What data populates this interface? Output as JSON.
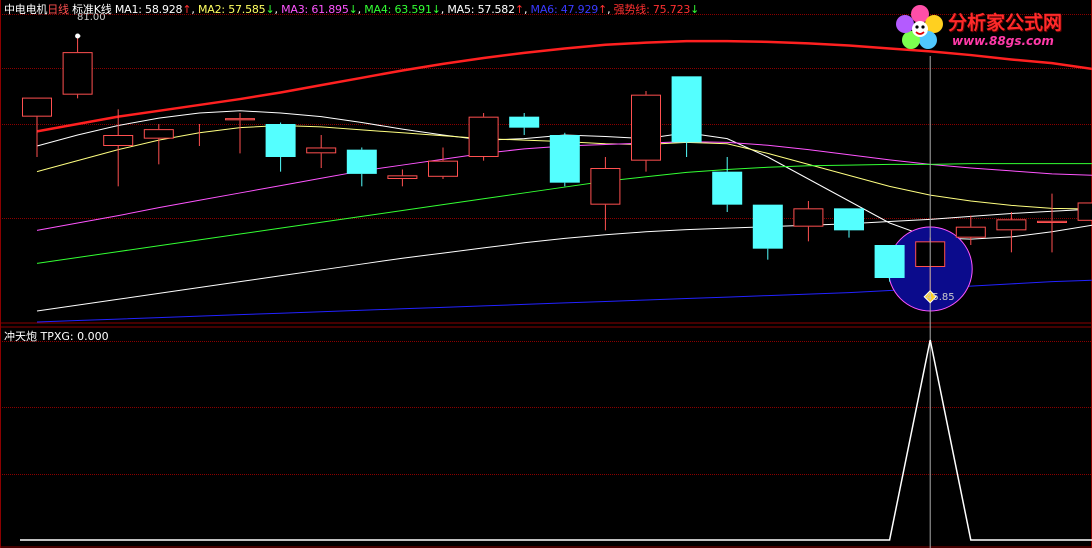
{
  "header": {
    "stock_name": "中电电机",
    "period": "日线",
    "chart_type": "标准K线",
    "ma1_label": "MA1:",
    "ma1_value": "58.928",
    "ma1_arrow": "↑",
    "ma2_label": "MA2:",
    "ma2_value": "57.585",
    "ma2_arrow": "↓",
    "ma3_label": "MA3:",
    "ma3_value": "61.895",
    "ma3_arrow": "↓",
    "ma4_label": "MA4:",
    "ma4_value": "63.591",
    "ma4_arrow": "↓",
    "ma5_label": "MA5:",
    "ma5_value": "57.582",
    "ma5_arrow": "↑",
    "ma6_label": "MA6:",
    "ma6_value": "47.929",
    "ma6_arrow": "↑",
    "trend_label": "强势线:",
    "trend_value": "75.723",
    "trend_arrow": "↓"
  },
  "indicator": {
    "name": "冲天炮",
    "field_label": "TPXG:",
    "field_value": "0.000"
  },
  "annotations": {
    "high_price": "81.00",
    "low_price": "45.85"
  },
  "logo": {
    "title": "分析家公式网",
    "url": "www.88gs.com"
  },
  "colors": {
    "background": "#000000",
    "grid": "#8b0000",
    "up_candle": "#ff5050",
    "down_candle": "#54ffff",
    "ma1": "#ffffff",
    "ma2": "#ffff80",
    "ma3": "#ff55ff",
    "ma4": "#33ff33",
    "ma5": "#ffffff",
    "ma6": "#2222ff",
    "trend": "#ff2020",
    "highlight_circle": "#0b0b8c"
  },
  "chart_data": {
    "type": "candlestick",
    "price_range": [
      42,
      84
    ],
    "candles": [
      {
        "o": 70.0,
        "h": 72.6,
        "l": 64.5,
        "c": 72.6
      },
      {
        "o": 73.0,
        "h": 81.0,
        "l": 72.5,
        "c": 78.8
      },
      {
        "o": 66.0,
        "h": 71.0,
        "l": 60.5,
        "c": 67.5
      },
      {
        "o": 67.0,
        "h": 69.0,
        "l": 63.5,
        "c": 68.3
      },
      {
        "o": 68.5,
        "h": 69.0,
        "l": 66.0,
        "c": 68.5
      },
      {
        "o": 69.5,
        "h": 70.5,
        "l": 65.0,
        "c": 69.8
      },
      {
        "o": 69.0,
        "h": 69.2,
        "l": 62.5,
        "c": 64.5
      },
      {
        "o": 65.0,
        "h": 67.5,
        "l": 63.0,
        "c": 65.8
      },
      {
        "o": 65.5,
        "h": 65.8,
        "l": 60.5,
        "c": 62.2
      },
      {
        "o": 61.5,
        "h": 62.8,
        "l": 60.5,
        "c": 62.0
      },
      {
        "o": 61.8,
        "h": 65.8,
        "l": 61.5,
        "c": 64.0
      },
      {
        "o": 64.5,
        "h": 70.5,
        "l": 64.0,
        "c": 70.0
      },
      {
        "o": 70.0,
        "h": 70.5,
        "l": 67.5,
        "c": 68.5
      },
      {
        "o": 67.5,
        "h": 67.8,
        "l": 60.5,
        "c": 61.0
      },
      {
        "o": 58.0,
        "h": 64.5,
        "l": 54.5,
        "c": 63.0
      },
      {
        "o": 64.0,
        "h": 73.5,
        "l": 62.5,
        "c": 73.0
      },
      {
        "o": 75.5,
        "h": 75.5,
        "l": 64.5,
        "c": 66.5
      },
      {
        "o": 62.5,
        "h": 64.5,
        "l": 57.0,
        "c": 58.0
      },
      {
        "o": 58.0,
        "h": 58.0,
        "l": 50.5,
        "c": 52.0
      },
      {
        "o": 55.0,
        "h": 58.5,
        "l": 53.0,
        "c": 57.5
      },
      {
        "o": 57.5,
        "h": 57.5,
        "l": 53.5,
        "c": 54.5
      },
      {
        "o": 52.5,
        "h": 52.5,
        "l": 47.5,
        "c": 48.0
      },
      {
        "o": 49.5,
        "h": 53.5,
        "l": 45.85,
        "c": 53.0
      },
      {
        "o": 53.5,
        "h": 56.5,
        "l": 52.5,
        "c": 55.0
      },
      {
        "o": 54.5,
        "h": 57.0,
        "l": 51.5,
        "c": 56.0
      },
      {
        "o": 55.5,
        "h": 59.5,
        "l": 51.5,
        "c": 55.8
      },
      {
        "o": 55.8,
        "h": 59.5,
        "l": 54.5,
        "c": 58.3
      },
      {
        "o": 55.0,
        "h": 62.0,
        "l": 54.5,
        "c": 57.5
      }
    ],
    "ma_lines": {
      "ma1": [
        66.0,
        67.5,
        68.8,
        69.8,
        70.5,
        70.8,
        70.5,
        70.0,
        69.2,
        68.3,
        67.5,
        66.8,
        67.0,
        67.5,
        67.3,
        67.0,
        67.8,
        67.0,
        64.5,
        61.5,
        58.5,
        55.5,
        53.5,
        53.3,
        53.6,
        54.3,
        55.2,
        57.0
      ],
      "ma2": [
        62.5,
        64.0,
        65.5,
        66.8,
        67.8,
        68.5,
        68.8,
        68.6,
        68.2,
        67.8,
        67.4,
        67.0,
        66.8,
        66.6,
        66.3,
        66.2,
        66.5,
        66.3,
        65.0,
        63.5,
        62.0,
        60.5,
        59.3,
        58.5,
        57.9,
        57.5,
        57.4,
        57.6
      ],
      "ma3": [
        54.5,
        55.5,
        56.5,
        57.6,
        58.6,
        59.6,
        60.6,
        61.6,
        62.6,
        63.4,
        64.2,
        65.0,
        65.6,
        66.0,
        66.2,
        66.4,
        66.6,
        66.5,
        66.1,
        65.5,
        64.8,
        64.1,
        63.5,
        63.0,
        62.6,
        62.2,
        62.0,
        61.9
      ],
      "ma4": [
        50.0,
        50.8,
        51.6,
        52.4,
        53.2,
        54.0,
        54.8,
        55.6,
        56.4,
        57.2,
        58.0,
        58.8,
        59.6,
        60.4,
        61.2,
        61.8,
        62.4,
        62.8,
        63.1,
        63.3,
        63.4,
        63.5,
        63.5,
        63.6,
        63.6,
        63.6,
        63.6,
        63.6
      ],
      "ma5": [
        43.5,
        44.3,
        45.1,
        45.9,
        46.7,
        47.5,
        48.3,
        49.1,
        49.9,
        50.7,
        51.4,
        52.1,
        52.8,
        53.4,
        53.9,
        54.3,
        54.6,
        54.8,
        55.0,
        55.2,
        55.4,
        55.7,
        56.0,
        56.4,
        56.8,
        57.1,
        57.4,
        57.6
      ],
      "ma6": [
        42.0,
        42.2,
        42.4,
        42.6,
        42.8,
        43.0,
        43.2,
        43.4,
        43.6,
        43.8,
        44.0,
        44.2,
        44.4,
        44.6,
        44.8,
        45.0,
        45.2,
        45.4,
        45.6,
        45.8,
        46.0,
        46.3,
        46.6,
        46.9,
        47.2,
        47.5,
        47.7,
        47.9
      ]
    },
    "trend_line": [
      68.0,
      69.0,
      70.0,
      70.8,
      71.6,
      72.4,
      73.3,
      74.3,
      75.3,
      76.3,
      77.2,
      78.0,
      78.7,
      79.3,
      79.8,
      80.1,
      80.3,
      80.3,
      80.2,
      80.0,
      79.7,
      79.3,
      78.9,
      78.4,
      77.8,
      77.3,
      76.5,
      75.7
    ],
    "highlight_index": 22,
    "indicator_values": [
      0,
      0,
      0,
      0,
      0,
      0,
      0,
      0,
      0,
      0,
      0,
      0,
      0,
      0,
      0,
      0,
      0,
      0,
      0,
      0,
      0,
      0,
      1,
      0,
      0,
      0,
      0,
      0
    ]
  }
}
